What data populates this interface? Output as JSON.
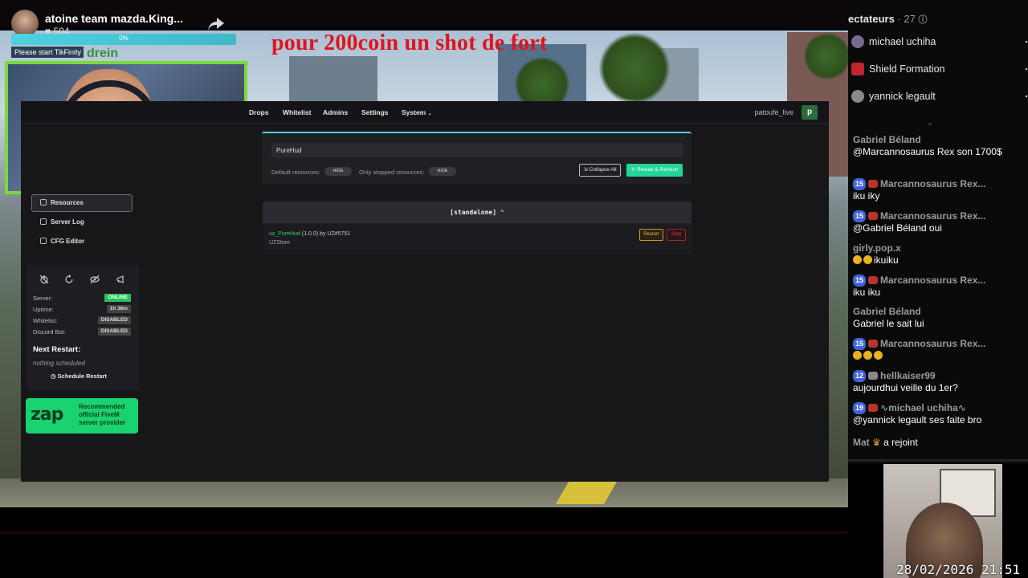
{
  "stream": {
    "streamer_name": "atoine team mazda.King...",
    "likes": "504",
    "banner": "pour 200coin un shot de fort",
    "tikfinity_percent": "0%",
    "tikfinity_start": "Please start TikFinity",
    "tikfinity_tag": "drein",
    "timestamp": "28/02/2026  21:51"
  },
  "topnav": {
    "items": [
      "Drops",
      "Whitelist",
      "Admins",
      "Settings",
      "System"
    ],
    "username": "patoufe_live",
    "avatar_letter": "p"
  },
  "sidebar": {
    "items": [
      "Resources",
      "Server Log",
      "CFG Editor"
    ]
  },
  "status": {
    "server_label": "Server:",
    "server_value": "ONLINE",
    "uptime_label": "Uptime:",
    "uptime_value": "1h 38m",
    "whitelist_label": "Whitelist:",
    "whitelist_value": "DISABLED",
    "discord_label": "Discord Bot:",
    "discord_value": "DISABLED",
    "next_restart_label": "Next Restart:",
    "next_restart_value": "nothing scheduled",
    "schedule_button": "Schedule Restart"
  },
  "zap": {
    "logo": "zap",
    "line1": "Recommended",
    "line2": "official FiveM",
    "line3": "server provider"
  },
  "resources": {
    "search_value": "PureHud",
    "default_label": "Default resources:",
    "default_toggle": "HIDE",
    "stopped_label": "Only stopped resources:",
    "stopped_toggle": "HIDE",
    "collapse_label": "Collapse All",
    "reload_label": "Reload & Refresh",
    "group_title": "[standalone]",
    "resource_name": "uz_PureHud",
    "resource_version": "(1.0.0) by UZ#5751",
    "resource_desc": "UZStore",
    "restart_label": "Restart",
    "stop_label": "Stop"
  },
  "chat": {
    "header": "ectateurs",
    "viewer_count": "· 27",
    "viewers": [
      "michael uchiha",
      "Shield Formation",
      "yannick legault"
    ],
    "messages": [
      {
        "user": "Gabriel Béland",
        "text": "@Marcannosaurus Rex  son 1700$"
      },
      {
        "level": "15",
        "user": "Marcannosaurus Rex...",
        "text": "iku iky"
      },
      {
        "level": "15",
        "user": "Marcannosaurus Rex...",
        "text": "@Gabriel Béland oui"
      },
      {
        "user": "girly.pop.x",
        "text": "ikuiku"
      },
      {
        "level": "15",
        "user": "Marcannosaurus Rex...",
        "text": "iku iku"
      },
      {
        "user": "Gabriel Béland",
        "text": "Gabriel le sait lui"
      },
      {
        "level": "15",
        "user": "Marcannosaurus Rex...",
        "text": ""
      },
      {
        "level": "12",
        "user": "hellkaiser99",
        "text": "aujourdhui veille du 1er?"
      },
      {
        "level": "19",
        "user": "michael uchiha",
        "text": "@yannick legault ses faite bro"
      },
      {
        "user": "Mat",
        "text": "a rejoint"
      }
    ]
  }
}
